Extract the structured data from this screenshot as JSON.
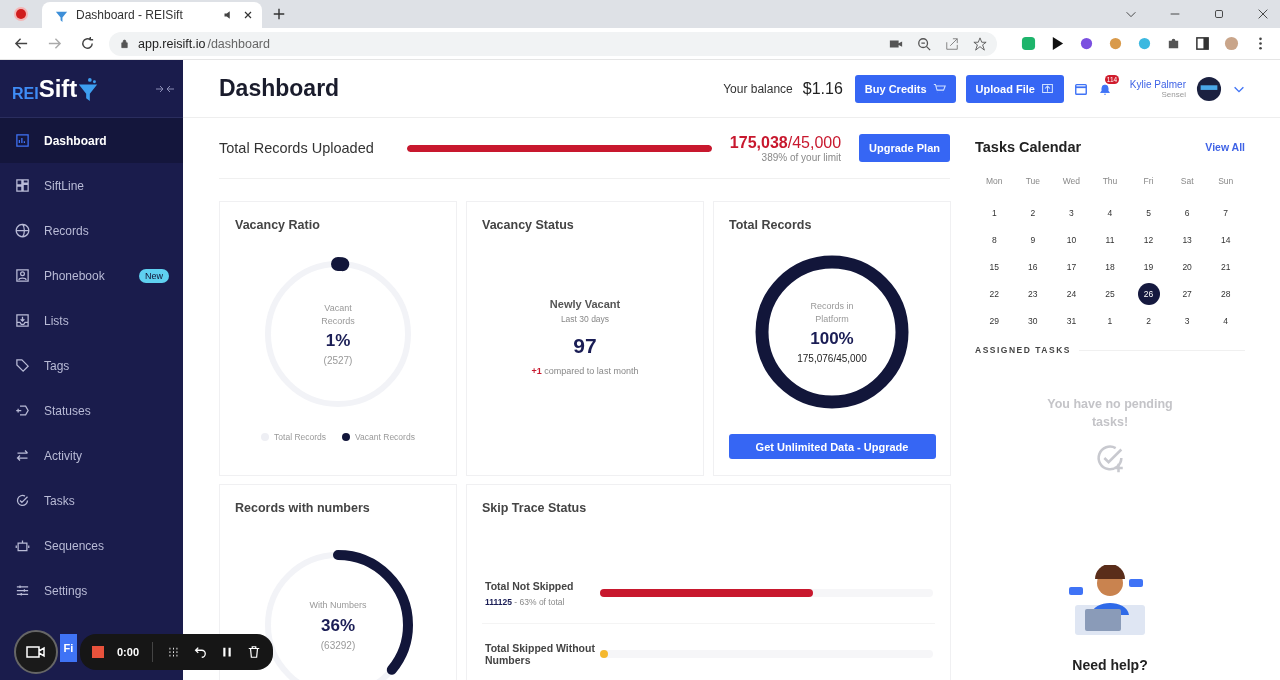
{
  "browser": {
    "tab_title": "Dashboard - REISift",
    "url_host": "app.reisift.io",
    "url_path": "/dashboard"
  },
  "sidebar": {
    "logo_prefix": "REI",
    "logo_main": "Sift",
    "items": [
      {
        "label": "Dashboard",
        "selected": true
      },
      {
        "label": "SiftLine",
        "selected": false
      },
      {
        "label": "Records",
        "selected": false
      },
      {
        "label": "Phonebook",
        "selected": false,
        "badge": "New"
      },
      {
        "label": "Lists",
        "selected": false
      },
      {
        "label": "Tags",
        "selected": false
      },
      {
        "label": "Statuses",
        "selected": false
      },
      {
        "label": "Activity",
        "selected": false
      },
      {
        "label": "Tasks",
        "selected": false
      },
      {
        "label": "Sequences",
        "selected": false
      },
      {
        "label": "Settings",
        "selected": false
      }
    ],
    "bottom_button": "Fi"
  },
  "header": {
    "title": "Dashboard",
    "balance_label": "Your balance",
    "balance": "$1.16",
    "buttons": [
      "Buy Credits",
      "Upload File"
    ],
    "notification_count": "114",
    "user_name": "Kylie Palmer",
    "user_role": "Sensei"
  },
  "usage": {
    "label": "Total Records Uploaded",
    "level": 1,
    "used": "175,038",
    "limit": "/45,000",
    "note": "389% of your limit",
    "button": "Upgrade Plan"
  },
  "vacancy_ratio": {
    "title": "Vacancy Ratio",
    "center_label": "Vacant Records",
    "value": "1%",
    "count": "(2527)",
    "level": 0.01,
    "legend": [
      {
        "label": "Total Records",
        "color": "#eeeff4"
      },
      {
        "label": "Vacant Records",
        "color": "#12163a"
      }
    ]
  },
  "vacancy_status": {
    "title": "Vacancy Status",
    "label": "Newly Vacant",
    "sublabel": "Last 30 days",
    "value": "97",
    "delta": "+1",
    "delta_note": "compared to last month"
  },
  "total_records": {
    "title": "Total Records",
    "center_label": "Records in Platform",
    "value": "100%",
    "count": "175,076/45,000",
    "level": 1,
    "button": "Get Unlimited Data - Upgrade"
  },
  "records_with_numbers": {
    "title": "Records with numbers",
    "center_label": "With Numbers",
    "value": "36%",
    "count": "(63292)",
    "level": 0.36
  },
  "skip_trace": {
    "title": "Skip Trace Status",
    "rows": [
      {
        "label": "Total Not Skipped",
        "count": "111125",
        "note": "- 63% of total",
        "level": 0.64,
        "color": "#c8182e"
      },
      {
        "label": "Total Skipped Without Numbers",
        "level": 0.025,
        "color": "#f5b82e"
      }
    ]
  },
  "calendar": {
    "title": "Tasks Calendar",
    "link": "View All",
    "weekdays": [
      "Mon",
      "Tue",
      "Wed",
      "Thu",
      "Fri",
      "Sat",
      "Sun"
    ],
    "days": [
      {
        "day": "1",
        "selected": false
      },
      {
        "day": "2",
        "selected": false
      },
      {
        "day": "3",
        "selected": false
      },
      {
        "day": "4",
        "selected": false
      },
      {
        "day": "5",
        "selected": false
      },
      {
        "day": "6",
        "selected": false
      },
      {
        "day": "7",
        "selected": false
      },
      {
        "day": "8",
        "selected": false
      },
      {
        "day": "9",
        "selected": false
      },
      {
        "day": "10",
        "selected": false
      },
      {
        "day": "11",
        "selected": false
      },
      {
        "day": "12",
        "selected": false
      },
      {
        "day": "13",
        "selected": false
      },
      {
        "day": "14",
        "selected": false
      },
      {
        "day": "15",
        "selected": false
      },
      {
        "day": "16",
        "selected": false
      },
      {
        "day": "17",
        "selected": false
      },
      {
        "day": "18",
        "selected": false
      },
      {
        "day": "19",
        "selected": false
      },
      {
        "day": "20",
        "selected": false
      },
      {
        "day": "21",
        "selected": false
      },
      {
        "day": "22",
        "selected": false
      },
      {
        "day": "23",
        "selected": false
      },
      {
        "day": "24",
        "selected": false
      },
      {
        "day": "25",
        "selected": false
      },
      {
        "day": "26",
        "selected": true
      },
      {
        "day": "27",
        "selected": false
      },
      {
        "day": "28",
        "selected": false
      },
      {
        "day": "29",
        "selected": false
      },
      {
        "day": "30",
        "selected": false
      },
      {
        "day": "31",
        "selected": false
      },
      {
        "day": "1",
        "selected": false
      },
      {
        "day": "2",
        "selected": false
      },
      {
        "day": "3",
        "selected": false
      },
      {
        "day": "4",
        "selected": false
      }
    ],
    "assigned_title": "ASSIGNED TASKS",
    "empty_message": "You have no pending tasks!",
    "help_title": "Need help?"
  },
  "recorder": {
    "time": "0:00"
  }
}
